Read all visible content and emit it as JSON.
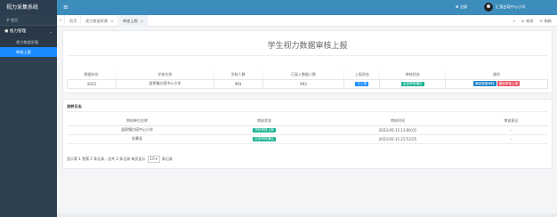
{
  "sidebar": {
    "brand": "视力采集系统",
    "home": "# 首页",
    "group": "▣ 视力管理",
    "group_caret": "⌄",
    "items": [
      {
        "label": "视力数据采集"
      },
      {
        "label": "审核上报"
      }
    ]
  },
  "topbar": {
    "menu_icon": "≡",
    "fullscreen": "✖ 全屏",
    "user_name": "汇报白塔中心小学"
  },
  "tabs": {
    "prev": "«",
    "next": "»",
    "items": [
      {
        "label": "首页"
      },
      {
        "label": "视力数据采集"
      },
      {
        "label": "审核上报"
      }
    ],
    "close_icon": "⊗",
    "tools": [
      "⊳ 关闭",
      "↻ 刷新"
    ]
  },
  "report": {
    "title": "学生视力数据审核上报",
    "columns": [
      "数据年份",
      "学校名称",
      "学校人数",
      "已录入数据人数",
      "上报状态",
      "审核状态",
      "操作"
    ],
    "row": {
      "year": "2022",
      "school": "温泉镇白塔中心小学",
      "students": "993",
      "entered": "993",
      "report_status": "已上报",
      "audit_status": "区县审核通过",
      "action_submit": "撤回数据审核",
      "action_revoke": "撤销审核上报"
    }
  },
  "log": {
    "title": "流转日志",
    "columns": [
      "审核单位名称",
      "审核状态",
      "审核时间",
      "审核意见"
    ],
    "rows": [
      {
        "unit": "温泉镇白塔中心小学",
        "status": "学校审核上报",
        "time": "2023-05-15 11:00:01",
        "opinion": "-"
      },
      {
        "unit": "金寨县",
        "status": "区县审核通过",
        "time": "2023-05-15 21:53:55",
        "opinion": "-"
      }
    ],
    "pager_prefix": "显示第 1 到第 2 条记录，总共 2 条记录 每页显示",
    "page_size": "10 ▾",
    "pager_suffix": "条记录"
  }
}
